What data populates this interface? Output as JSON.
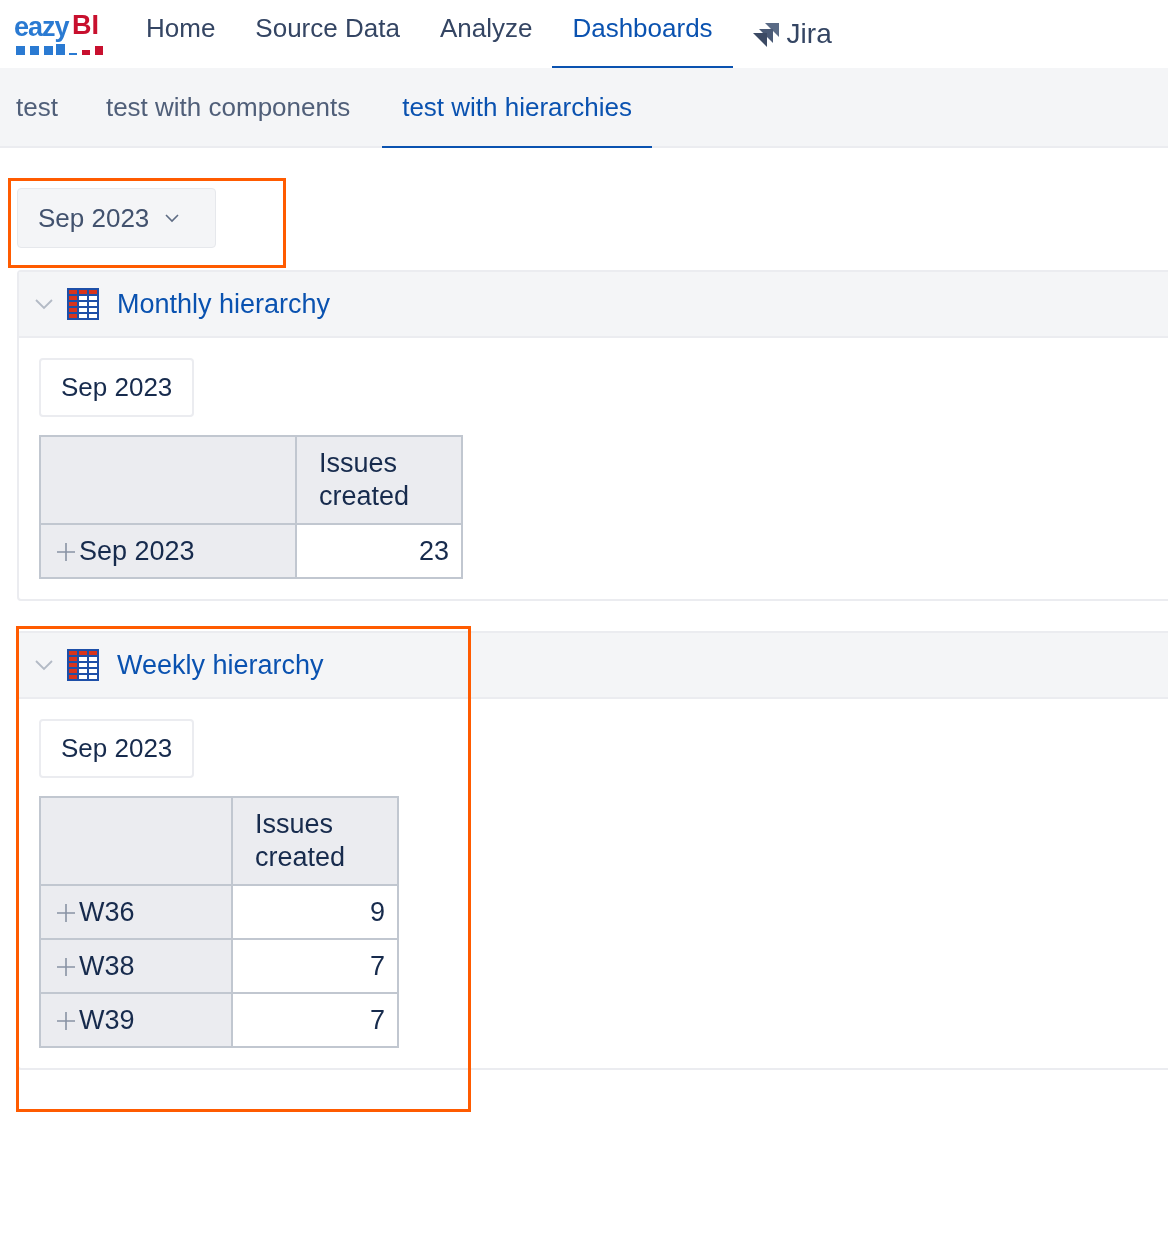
{
  "top_nav": {
    "logo": {
      "left": "eazy",
      "right": "BI"
    },
    "items": [
      {
        "label": "Home",
        "selected": false
      },
      {
        "label": "Source Data",
        "selected": false
      },
      {
        "label": "Analyze",
        "selected": false
      },
      {
        "label": "Dashboards",
        "selected": true
      }
    ],
    "jira_link": "Jira"
  },
  "tabs": [
    {
      "label": "test",
      "selected": false
    },
    {
      "label": "test with components",
      "selected": false
    },
    {
      "label": "test with hierarchies",
      "selected": true
    }
  ],
  "page_filter": {
    "value": "Sep 2023"
  },
  "reports": [
    {
      "title": "Monthly hierarchy",
      "expanded": true,
      "highlighted": false,
      "filter": "Sep 2023",
      "header": "Issues created",
      "rows": [
        {
          "label": "Sep 2023",
          "value": "23"
        }
      ]
    },
    {
      "title": "Weekly hierarchy",
      "expanded": true,
      "highlighted": true,
      "filter": "Sep 2023",
      "header": "Issues created",
      "rows": [
        {
          "label": "W36",
          "value": "9"
        },
        {
          "label": "W38",
          "value": "7"
        },
        {
          "label": "W39",
          "value": "7"
        }
      ]
    }
  ]
}
